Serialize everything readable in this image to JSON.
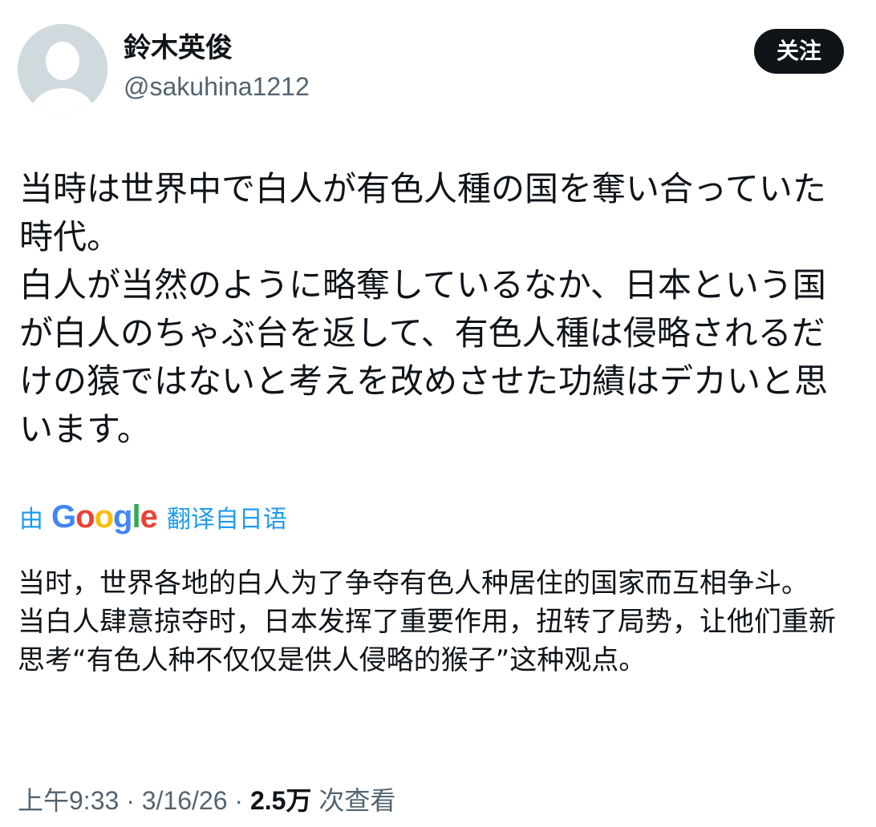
{
  "user": {
    "display_name": "鈴木英俊",
    "handle": "@sakuhina1212",
    "follow_label": "关注"
  },
  "tweet": {
    "original_text": "当時は世界中で白人が有色人種の国を奪い合っていた時代。\n白人が当然のように略奪しているなか、日本という国が白人のちゃぶ台を返して、有色人種は侵略されるだけの猿ではないと考えを改めさせた功績はデカいと思います。",
    "translate": {
      "by_label": "由",
      "google_logo_letters": [
        "G",
        "o",
        "o",
        "g",
        "l",
        "e"
      ],
      "google_logo_colors": [
        "#4285f4",
        "#ea4335",
        "#fbbc05",
        "#4285f4",
        "#34a853",
        "#ea4335"
      ],
      "action_label": "翻译自日语"
    },
    "translated_text": "当时，世界各地的白人为了争夺有色人种居住的国家而互相争斗。\n当白人肆意掠夺时，日本发挥了重要作用，扭转了局势，让他们重新思考“有色人种不仅仅是供人侵略的猴子”这种观点。",
    "meta": {
      "time": "上午9:33",
      "separator": " · ",
      "date": "3/16/26",
      "views_count": "2.5万",
      "views_label": "次查看"
    }
  },
  "colors": {
    "accent": "#1d9bf0",
    "text_primary": "#0f1419",
    "text_secondary": "#536471",
    "avatar_bg": "#cfd9de",
    "avatar_figure": "#ffffff"
  },
  "icons": {
    "avatar": "default-person-silhouette"
  }
}
